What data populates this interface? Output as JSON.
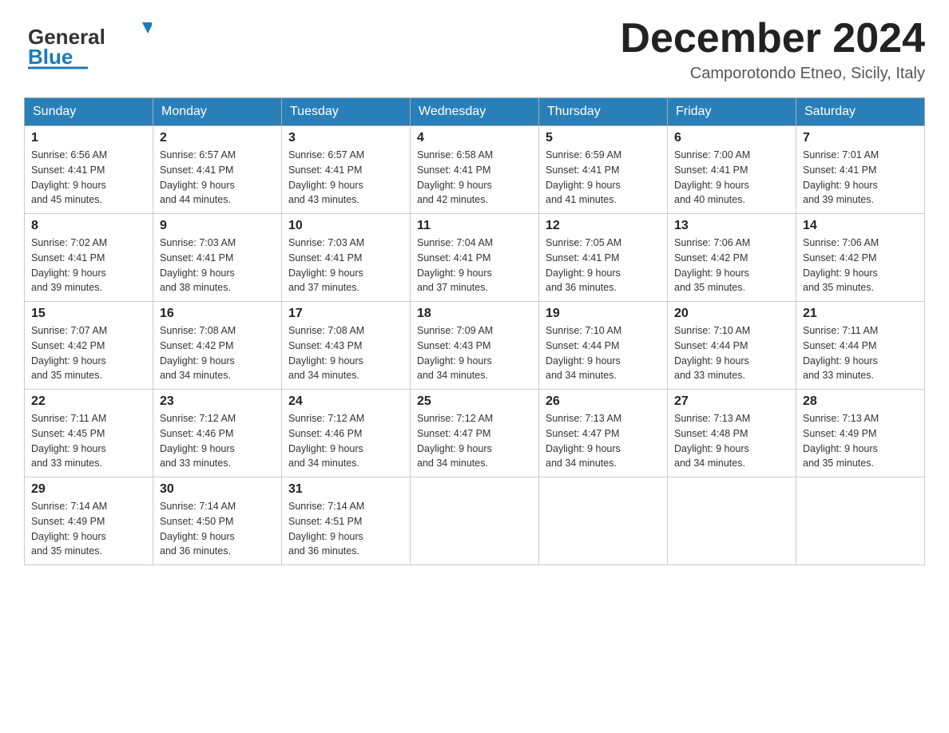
{
  "header": {
    "logo_general": "General",
    "logo_blue": "Blue",
    "month_title": "December 2024",
    "location": "Camporotondo Etneo, Sicily, Italy"
  },
  "days_of_week": [
    "Sunday",
    "Monday",
    "Tuesday",
    "Wednesday",
    "Thursday",
    "Friday",
    "Saturday"
  ],
  "weeks": [
    [
      {
        "day": "1",
        "sunrise": "6:56 AM",
        "sunset": "4:41 PM",
        "daylight": "9 hours and 45 minutes."
      },
      {
        "day": "2",
        "sunrise": "6:57 AM",
        "sunset": "4:41 PM",
        "daylight": "9 hours and 44 minutes."
      },
      {
        "day": "3",
        "sunrise": "6:57 AM",
        "sunset": "4:41 PM",
        "daylight": "9 hours and 43 minutes."
      },
      {
        "day": "4",
        "sunrise": "6:58 AM",
        "sunset": "4:41 PM",
        "daylight": "9 hours and 42 minutes."
      },
      {
        "day": "5",
        "sunrise": "6:59 AM",
        "sunset": "4:41 PM",
        "daylight": "9 hours and 41 minutes."
      },
      {
        "day": "6",
        "sunrise": "7:00 AM",
        "sunset": "4:41 PM",
        "daylight": "9 hours and 40 minutes."
      },
      {
        "day": "7",
        "sunrise": "7:01 AM",
        "sunset": "4:41 PM",
        "daylight": "9 hours and 39 minutes."
      }
    ],
    [
      {
        "day": "8",
        "sunrise": "7:02 AM",
        "sunset": "4:41 PM",
        "daylight": "9 hours and 39 minutes."
      },
      {
        "day": "9",
        "sunrise": "7:03 AM",
        "sunset": "4:41 PM",
        "daylight": "9 hours and 38 minutes."
      },
      {
        "day": "10",
        "sunrise": "7:03 AM",
        "sunset": "4:41 PM",
        "daylight": "9 hours and 37 minutes."
      },
      {
        "day": "11",
        "sunrise": "7:04 AM",
        "sunset": "4:41 PM",
        "daylight": "9 hours and 37 minutes."
      },
      {
        "day": "12",
        "sunrise": "7:05 AM",
        "sunset": "4:41 PM",
        "daylight": "9 hours and 36 minutes."
      },
      {
        "day": "13",
        "sunrise": "7:06 AM",
        "sunset": "4:42 PM",
        "daylight": "9 hours and 35 minutes."
      },
      {
        "day": "14",
        "sunrise": "7:06 AM",
        "sunset": "4:42 PM",
        "daylight": "9 hours and 35 minutes."
      }
    ],
    [
      {
        "day": "15",
        "sunrise": "7:07 AM",
        "sunset": "4:42 PM",
        "daylight": "9 hours and 35 minutes."
      },
      {
        "day": "16",
        "sunrise": "7:08 AM",
        "sunset": "4:42 PM",
        "daylight": "9 hours and 34 minutes."
      },
      {
        "day": "17",
        "sunrise": "7:08 AM",
        "sunset": "4:43 PM",
        "daylight": "9 hours and 34 minutes."
      },
      {
        "day": "18",
        "sunrise": "7:09 AM",
        "sunset": "4:43 PM",
        "daylight": "9 hours and 34 minutes."
      },
      {
        "day": "19",
        "sunrise": "7:10 AM",
        "sunset": "4:44 PM",
        "daylight": "9 hours and 34 minutes."
      },
      {
        "day": "20",
        "sunrise": "7:10 AM",
        "sunset": "4:44 PM",
        "daylight": "9 hours and 33 minutes."
      },
      {
        "day": "21",
        "sunrise": "7:11 AM",
        "sunset": "4:44 PM",
        "daylight": "9 hours and 33 minutes."
      }
    ],
    [
      {
        "day": "22",
        "sunrise": "7:11 AM",
        "sunset": "4:45 PM",
        "daylight": "9 hours and 33 minutes."
      },
      {
        "day": "23",
        "sunrise": "7:12 AM",
        "sunset": "4:46 PM",
        "daylight": "9 hours and 33 minutes."
      },
      {
        "day": "24",
        "sunrise": "7:12 AM",
        "sunset": "4:46 PM",
        "daylight": "9 hours and 34 minutes."
      },
      {
        "day": "25",
        "sunrise": "7:12 AM",
        "sunset": "4:47 PM",
        "daylight": "9 hours and 34 minutes."
      },
      {
        "day": "26",
        "sunrise": "7:13 AM",
        "sunset": "4:47 PM",
        "daylight": "9 hours and 34 minutes."
      },
      {
        "day": "27",
        "sunrise": "7:13 AM",
        "sunset": "4:48 PM",
        "daylight": "9 hours and 34 minutes."
      },
      {
        "day": "28",
        "sunrise": "7:13 AM",
        "sunset": "4:49 PM",
        "daylight": "9 hours and 35 minutes."
      }
    ],
    [
      {
        "day": "29",
        "sunrise": "7:14 AM",
        "sunset": "4:49 PM",
        "daylight": "9 hours and 35 minutes."
      },
      {
        "day": "30",
        "sunrise": "7:14 AM",
        "sunset": "4:50 PM",
        "daylight": "9 hours and 36 minutes."
      },
      {
        "day": "31",
        "sunrise": "7:14 AM",
        "sunset": "4:51 PM",
        "daylight": "9 hours and 36 minutes."
      },
      null,
      null,
      null,
      null
    ]
  ],
  "labels": {
    "sunrise": "Sunrise:",
    "sunset": "Sunset:",
    "daylight": "Daylight:"
  }
}
